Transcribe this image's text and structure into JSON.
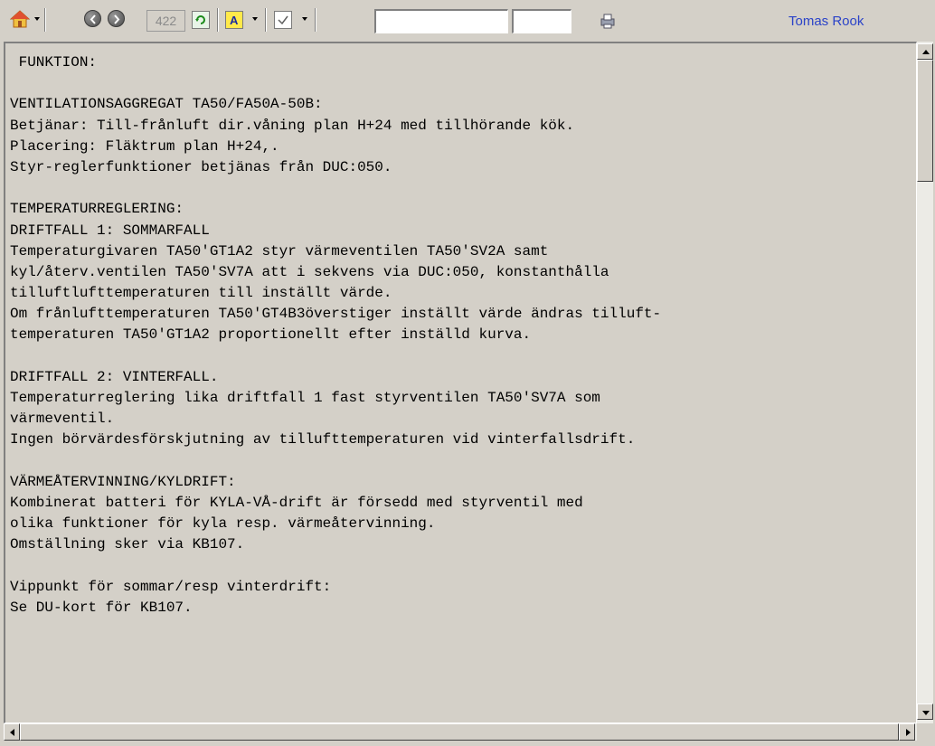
{
  "toolbar": {
    "page_number": "422",
    "user_name": "Tomas Rook",
    "icons": [
      "home-icon",
      "back-icon",
      "forward-icon",
      "refresh-icon",
      "font-icon",
      "checkbox-icon",
      "print-icon"
    ]
  },
  "document": {
    "lines": [
      " FUNKTION:",
      "",
      "VENTILATIONSAGGREGAT TA50/FA50A-50B:",
      "Betjänar: Till-frånluft dir.våning plan H+24 med tillhörande kök.",
      "Placering: Fläktrum plan H+24,.",
      "Styr-reglerfunktioner betjänas från DUC:050.",
      "",
      "TEMPERATURREGLERING:",
      "DRIFTFALL 1: SOMMARFALL",
      "Temperaturgivaren TA50'GT1A2 styr värmeventilen TA50'SV2A samt",
      "kyl/återv.ventilen TA50'SV7A att i sekvens via DUC:050, konstanthålla",
      "tilluftlufttemperaturen till inställt värde.",
      "Om frånlufttemperaturen TA50'GT4B3överstiger inställt värde ändras tilluft-",
      "temperaturen TA50'GT1A2 proportionellt efter inställd kurva.",
      "",
      "DRIFTFALL 2: VINTERFALL.",
      "Temperaturreglering lika driftfall 1 fast styrventilen TA50'SV7A som",
      "värmeventil.",
      "Ingen börvärdesförskjutning av tillufttemperaturen vid vinterfallsdrift.",
      "",
      "VÄRMEÅTERVINNING/KYLDRIFT:",
      "Kombinerat batteri för KYLA-VÅ-drift är försedd med styrventil med",
      "olika funktioner för kyla resp. värmeåtervinning.",
      "Omställning sker via KB107.",
      "",
      "Vippunkt för sommar/resp vinterdrift:",
      "Se DU-kort för KB107."
    ]
  },
  "colors": {
    "background": "#d4d0c8",
    "user_link": "#2b43c8"
  }
}
